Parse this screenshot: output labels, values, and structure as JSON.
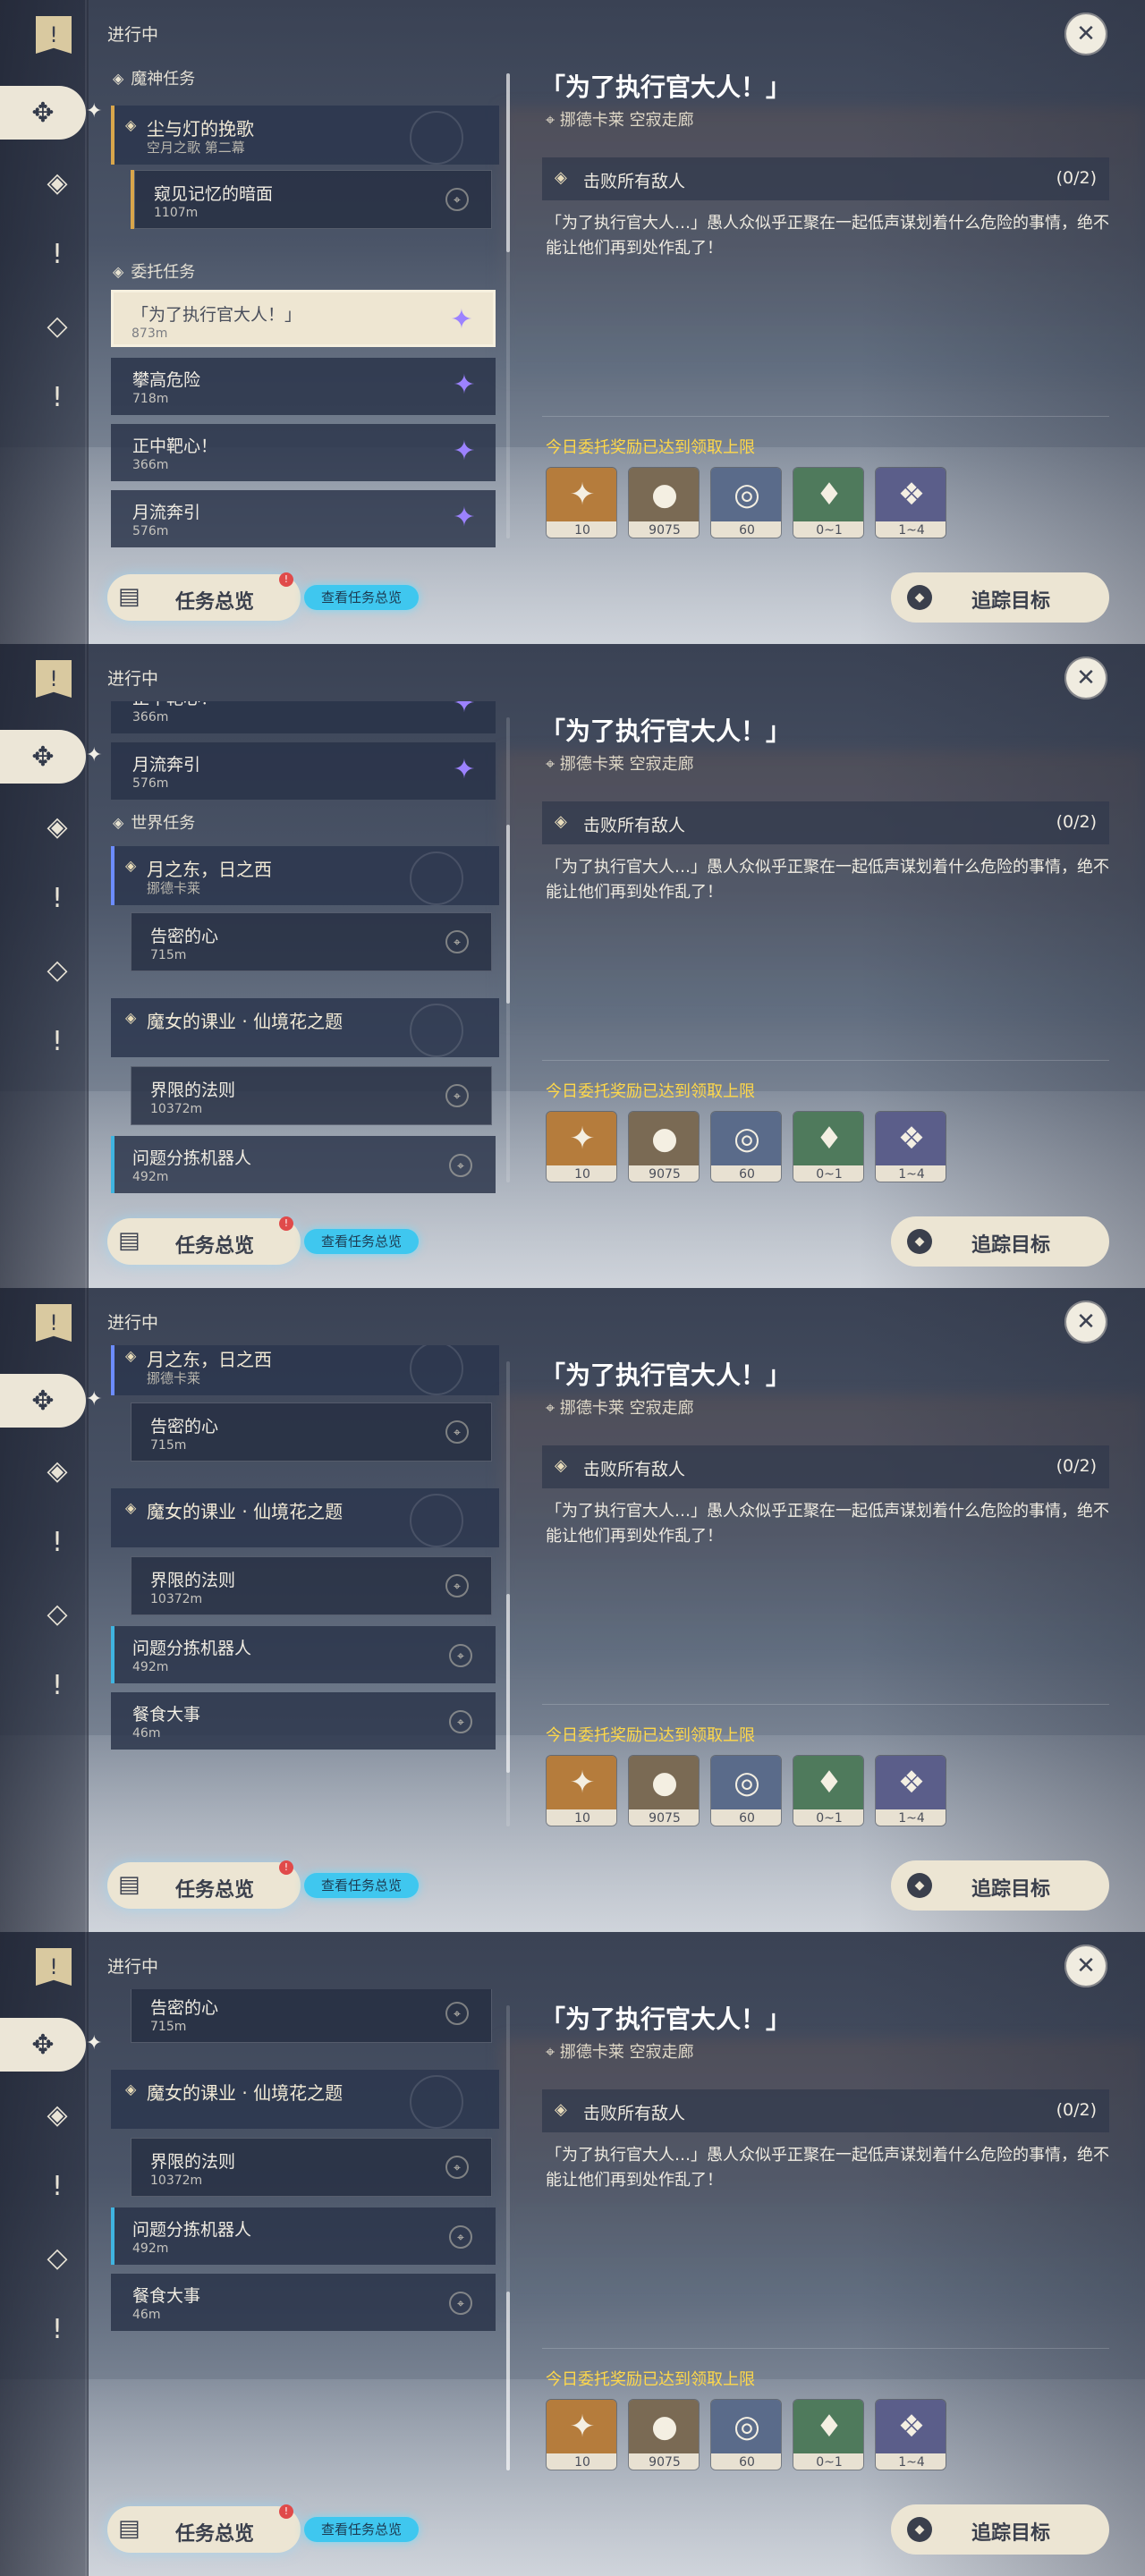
{
  "common": {
    "in_progress": "进行中",
    "overview_label": "任务总览",
    "view_overview_label": "查看任务总览",
    "track_label": "追踪目标",
    "quest_title": "「为了执行官大人！」",
    "quest_location": "挪德卡莱 空寂走廊",
    "objective_label": "击败所有敌人",
    "objective_count": "(0/2)",
    "description": "「为了执行官大人…」愚人众似乎正聚在一起低声谋划着什么危险的事情，绝不能让他们再到处作乱了！",
    "reward_note": "今日委托奖励已达到领取上限",
    "rewards": [
      {
        "icon": "star-glint-icon",
        "count": "10",
        "color": "#b57c3c"
      },
      {
        "icon": "mora-coin-icon",
        "count": "9075",
        "color": "#7a6a54"
      },
      {
        "icon": "ring-icon",
        "count": "60",
        "color": "#5a6b8a"
      },
      {
        "icon": "crystal-icon",
        "count": "0~1",
        "color": "#4f7a5c"
      },
      {
        "icon": "crystal-cluster-icon",
        "count": "1~4",
        "color": "#5b5e8a"
      }
    ]
  },
  "list_text": {
    "sec_archon": "魔神任务",
    "archon_title": "尘与灯的挽歌",
    "archon_sub": "空月之歌 第二幕",
    "archon_step": "窥见记忆的暗面",
    "archon_step_dist": "1107m",
    "sec_commission": "委托任务",
    "c1": "「为了执行官大人！」",
    "c1d": "873m",
    "c2": "攀高危险",
    "c2d": "718m",
    "c3": "正中靶心！",
    "c3d": "366m",
    "c4": "月流奔引",
    "c4d": "576m",
    "sec_world": "世界任务",
    "w1": "月之东，日之西",
    "w1d": "挪德卡莱",
    "w1s": "告密的心",
    "w1sd": "715m",
    "w2": "魔女的课业 · 仙境花之题",
    "w2s": "界限的法则",
    "w2sd": "10372m",
    "w3": "问题分拣机器人",
    "w3d": "492m",
    "w4": "餐食大事",
    "w4d": "46m"
  }
}
